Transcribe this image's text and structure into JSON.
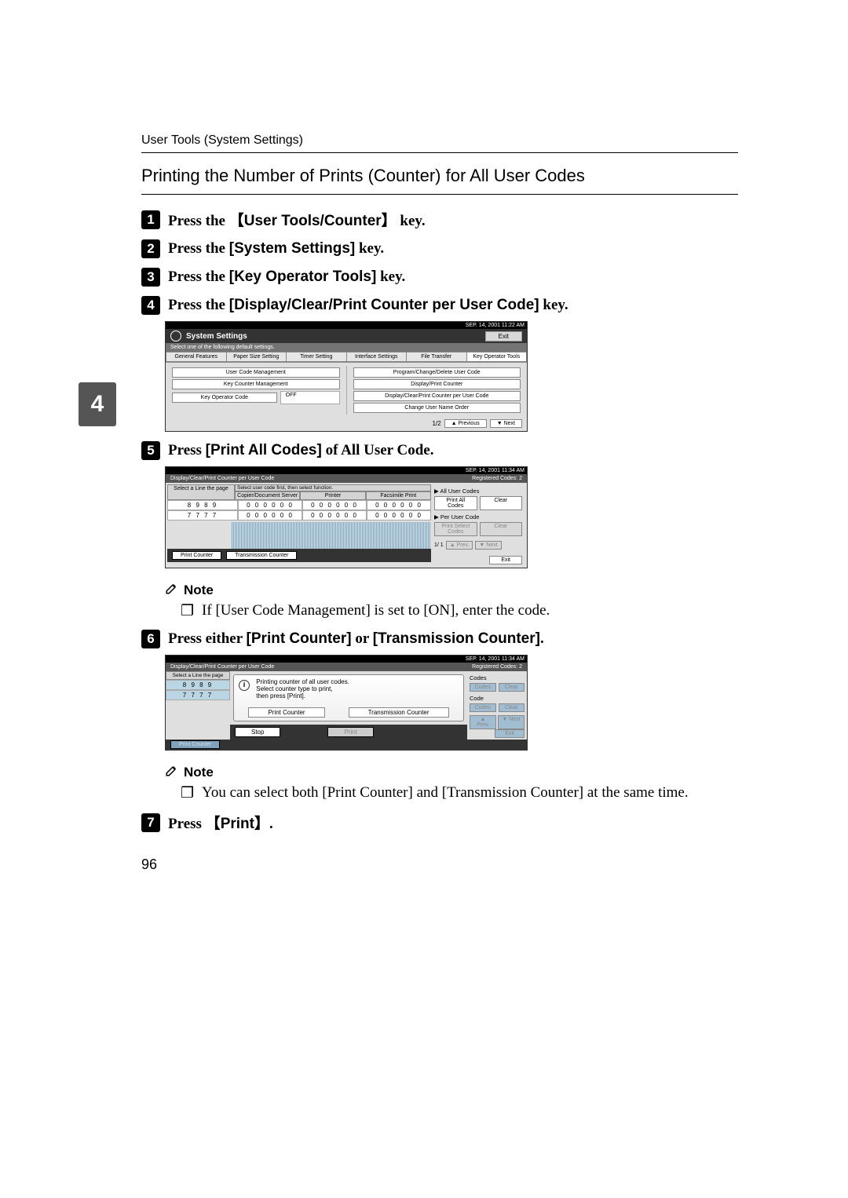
{
  "header": "User Tools (System Settings)",
  "section_title": "Printing the Number of Prints (Counter) for All User Codes",
  "chapter_tab": "4",
  "steps": {
    "s1": {
      "prefix": "Press the ",
      "key": "User Tools/Counter",
      "suffix": " key."
    },
    "s2": {
      "prefix": "Press the ",
      "key": "[System Settings]",
      "suffix": " key."
    },
    "s3": {
      "prefix": "Press the ",
      "key": "[Key Operator Tools]",
      "suffix": " key."
    },
    "s4": {
      "prefix": "Press the ",
      "key": "[Display/Clear/Print Counter per User Code]",
      "suffix": " key."
    },
    "s5": {
      "prefix": "Press ",
      "key": "[Print All Codes]",
      "suffix": " of All User Code."
    },
    "s6": {
      "prefix": "Press either ",
      "key1": "[Print Counter]",
      "mid": " or ",
      "key2": "[Transmission Counter]",
      "suffix": "."
    },
    "s7": {
      "prefix": "Press ",
      "key": "Print",
      "suffix": "."
    }
  },
  "notes": {
    "label": "Note",
    "n1": {
      "pre": "If ",
      "b1": "[User Code Management]",
      "mid": " is set to ",
      "b2": "[ON]",
      "post": ", enter the code."
    },
    "n2": {
      "pre": "You can select both ",
      "b1": "[Print Counter]",
      "mid": " and ",
      "b2": "[Transmission Counter]",
      "post": " at the same time."
    }
  },
  "ss1": {
    "date": "SEP.   14, 2001   11:22 AM",
    "title": "System Settings",
    "exit": "Exit",
    "subhead": "Select one of the following default settings.",
    "tabs": [
      "General Features",
      "Paper Size Setting",
      "Timer Setting",
      "Interface Settings",
      "File Transfer",
      "Key Operator Tools"
    ],
    "left": [
      "User Code Management",
      "Key Counter Management",
      "Key Operator Code"
    ],
    "left_val": "OFF",
    "right": [
      "Program/Change/Delete User Code",
      "Display/Print Counter",
      "Display/Clear/Print Counter per User Code",
      "Change User Name Order"
    ],
    "page": "1/2",
    "prev": "▲ Previous",
    "next": "▼ Next"
  },
  "ss2": {
    "date": "SEP.   14, 2001   11:34 AM",
    "title": "Display/Clear/Print Counter per User Code",
    "reg": "Registered Codes:",
    "reg_n": "2",
    "head_first": "Select a Line the page",
    "head_second": "Select user code first, then select function.",
    "cols": [
      "Copier/Document Server",
      "Printer",
      "Facsimile Print"
    ],
    "rows": [
      {
        "code": "8 9 8 9",
        "vals": [
          "0 0 0 0 0 0",
          "0 0 0 0 0 0",
          "0 0 0 0 0 0"
        ]
      },
      {
        "code": "7 7 7 7",
        "vals": [
          "0 0 0 0 0 0",
          "0 0 0 0 0 0",
          "0 0 0 0 0 0"
        ]
      }
    ],
    "r_all": "▶ All User Codes",
    "r_print_all": "Print All Codes",
    "r_clear": "Clear",
    "r_per": "▶ Per User Code",
    "r_print_sel": "Print Select Codes",
    "r_clear2": "Clear",
    "r_page": "1/   1",
    "r_prev": "▲ Prev.",
    "r_next": "▼ Next",
    "r_exit": "Exit",
    "b_print": "Print Counter",
    "b_trans": "Transmission Counter"
  },
  "ss3": {
    "date": "SEP.   14, 2001   11:34 AM",
    "title": "Display/Clear/Print Counter per User Code",
    "reg": "Registered Codes:",
    "reg_n": "2",
    "head_first": "Select a Line the page",
    "left_codes": [
      "8 9 8 9",
      "7 7 7 7"
    ],
    "msg1": "Printing counter of all user codes.",
    "msg2": "Select counter type to print,",
    "msg3": "then press [Print].",
    "btn1": "Print Counter",
    "btn2": "Transmission Counter",
    "stop": "Stop",
    "print": "Print",
    "codes_lbl": "Codes",
    "btns_r_top": [
      "Codes",
      "Clear"
    ],
    "code_lbl": "Code",
    "btns_r_mid": [
      "Codes",
      "Clear"
    ],
    "r_prev": "▲ Prev.",
    "r_next": "▼ Next",
    "r_exit": "Exit",
    "b_print": "Print Counter"
  },
  "page_number": "96"
}
